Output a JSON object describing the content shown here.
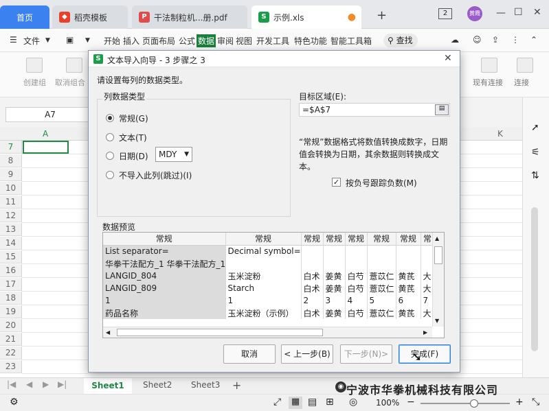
{
  "tabs": {
    "home": "首页",
    "t1": "稻壳模板",
    "t2": "干法制粒机...册.pdf",
    "t3": "示例.xls",
    "add": "+",
    "badge": "2",
    "avatar": "黄霞"
  },
  "menu": {
    "file": "文件",
    "items": [
      "开始",
      "插入",
      "页面布局",
      "公式",
      "数据",
      "审阅",
      "视图",
      "开发工具",
      "特色功能",
      "智能工具箱"
    ],
    "search": "查找"
  },
  "ribbon": {
    "left": [
      "创建组",
      "取消组合"
    ],
    "right": [
      "现有连接",
      "连接"
    ]
  },
  "formula": {
    "namebox": "A7"
  },
  "grid": {
    "col_a": "A",
    "col_k": "K",
    "rows": [
      "7",
      "8",
      "9",
      "10",
      "11",
      "12",
      "13",
      "14",
      "15",
      "16",
      "17",
      "18",
      "19",
      "20",
      "21",
      "22",
      "23"
    ]
  },
  "dialog": {
    "title": "文本导入向导 - 3 步骤之 3",
    "close": "✕",
    "prompt": "请设置每列的数据类型。",
    "group_label": "列数据类型",
    "opt_general": "常规(G)",
    "opt_text": "文本(T)",
    "opt_date": "日期(D)",
    "date_format": "MDY",
    "opt_skip": "不导入此列(跳过)(I)",
    "dest_label": "目标区域(E):",
    "dest_value": "=$A$7",
    "desc": "“常规”数据格式将数值转换成数字，日期值会转换为日期，其余数据则转换成文本。",
    "checkbox_label": "按负号跟踪负数(M)",
    "preview_label": "数据预览",
    "preview_headers": [
      "常规",
      "常规",
      "常规",
      "常规",
      "常规",
      "常规",
      "常规",
      "常"
    ],
    "preview_rows": [
      [
        "List separator=",
        "Decimal symbol=.",
        "",
        "",
        "",
        "",
        "",
        ""
      ],
      [
        "华拳干法配方_1 华拳干法配方_1",
        "",
        "",
        "",
        "",
        "",
        "",
        ""
      ],
      [
        "LANGID_804",
        "玉米淀粉",
        "白术",
        "姜黄",
        "白芍",
        "薏苡仁",
        "黄芪",
        "大"
      ],
      [
        "LANGID_809",
        "Starch",
        "白术",
        "姜黄",
        "白芍",
        "薏苡仁",
        "黄芪",
        "大"
      ],
      [
        "1",
        "1",
        "2",
        "3",
        "4",
        "5",
        "6",
        "7"
      ],
      [
        "药品名称",
        "玉米淀粉（示例）",
        "白术",
        "姜黄",
        "白芍",
        "薏苡仁",
        "黄芪",
        "大"
      ]
    ],
    "btn_cancel": "取消",
    "btn_back": "< 上一步(B)",
    "btn_next": "下一步(N)>",
    "btn_finish": "完成(F)"
  },
  "sheets": [
    "Sheet1",
    "Sheet2",
    "Sheet3"
  ],
  "status": {
    "zoom": "100%"
  },
  "watermark": "宁波市华拳机械科技有限公司"
}
